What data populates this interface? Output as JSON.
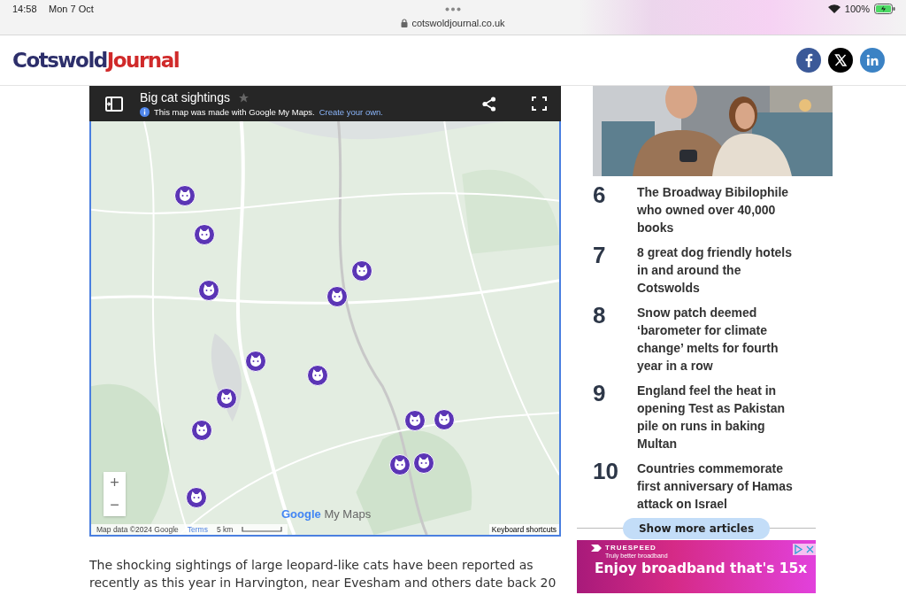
{
  "status_bar": {
    "time": "14:58",
    "date": "Mon 7 Oct",
    "url": "cotswoldjournal.co.uk",
    "battery": "100%"
  },
  "header": {
    "logo_part_1": "Cotswold",
    "logo_part_2": "Journal"
  },
  "map": {
    "title": "Big cat sightings",
    "starred": false,
    "notice": "This map was made with Google My Maps.",
    "notice_link": "Create your own.",
    "logo": "Google",
    "logo_suffix": "My Maps",
    "attribution": "Map data ©2024 Google",
    "terms": "Terms",
    "scale": "5 km",
    "shortcuts": "Keyboard shortcuts",
    "zoom_in": "+",
    "zoom_out": "−"
  },
  "articles": [
    {
      "rank": "6",
      "title": "The Broadway Bibilophile who owned over 40,000 books"
    },
    {
      "rank": "7",
      "title": "8 great dog friendly hotels in and around the Cotswolds"
    },
    {
      "rank": "8",
      "title": "Snow patch deemed ‘barometer for climate change’ melts for fourth year in a row"
    },
    {
      "rank": "9",
      "title": "England feel the heat in opening Test as Pakistan pile on runs in baking Multan"
    },
    {
      "rank": "10",
      "title": "Countries commemorate first anniversary of Hamas attack on Israel"
    }
  ],
  "show_more": "Show more articles",
  "ad": {
    "brand": "TRUESPEED",
    "tagline": "Truly better broadband",
    "headline": "Enjoy broadband that's 15x"
  },
  "article_text": "The shocking sightings of large leopard-like cats have been reported as recently as this year in Harvington, near Evesham and others date back 20"
}
